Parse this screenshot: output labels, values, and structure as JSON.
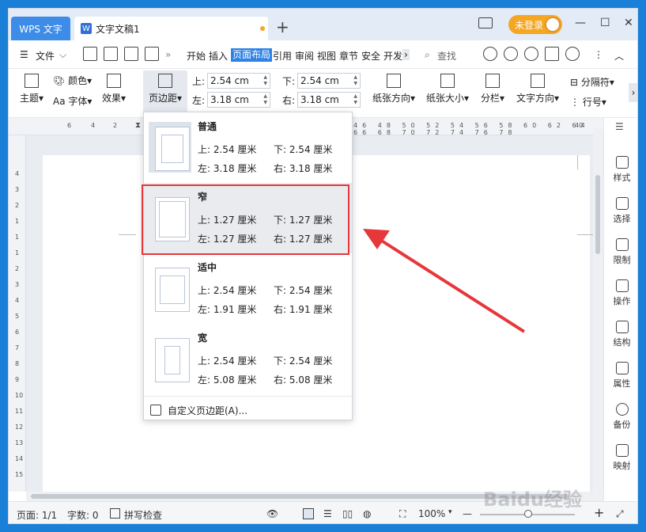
{
  "titlebar": {
    "app_tab": "WPS 文字",
    "doc_tab": "文字文稿1",
    "doc_icon": "W",
    "new_tab": "+",
    "login": "未登录",
    "window_controls": [
      "—",
      "☐",
      "✕"
    ]
  },
  "menubar": {
    "file_label": "文件",
    "tabs": [
      "开始",
      "插入",
      "页面布局",
      "引用",
      "审阅",
      "视图",
      "章节",
      "安全",
      "开发"
    ],
    "active_tab": "页面布局",
    "search_label": "查找"
  },
  "ribbon": {
    "theme": "主题",
    "color": "颜色",
    "font": "字体",
    "effect": "效果",
    "margins": "页边距",
    "top_label": "上:",
    "top_value": "2.54 cm",
    "bottom_label": "下:",
    "bottom_value": "2.54 cm",
    "left_label": "左:",
    "left_value": "3.18 cm",
    "right_label": "右:",
    "right_value": "3.18 cm",
    "orientation": "纸张方向",
    "size": "纸张大小",
    "columns": "分栏",
    "text_direction": "文字方向",
    "separator": "分隔符",
    "line_number": "行号"
  },
  "ruler": {
    "h_ticks": [
      "6",
      "4",
      "2",
      "40"
    ],
    "v_ticks": [
      "4",
      "3",
      "2",
      "1",
      "1",
      "1",
      "2",
      "3",
      "4",
      "5",
      "6",
      "7",
      "8",
      "9",
      "10",
      "11",
      "12",
      "13",
      "14",
      "15"
    ]
  },
  "margins_dropdown": {
    "options": [
      {
        "name": "普通",
        "top": "上: 2.54 厘米",
        "bottom": "下: 2.54 厘米",
        "left": "左: 3.18 厘米",
        "right": "右: 3.18 厘米"
      },
      {
        "name": "窄",
        "top": "上: 1.27 厘米",
        "bottom": "下: 1.27 厘米",
        "left": "左: 1.27 厘米",
        "right": "右: 1.27 厘米"
      },
      {
        "name": "适中",
        "top": "上: 2.54 厘米",
        "bottom": "下: 2.54 厘米",
        "left": "左: 1.91 厘米",
        "right": "右: 1.91 厘米"
      },
      {
        "name": "宽",
        "top": "上: 2.54 厘米",
        "bottom": "下: 2.54 厘米",
        "left": "左: 5.08 厘米",
        "right": "右: 5.08 厘米"
      }
    ],
    "custom": "自定义页边距(A)..."
  },
  "side_panel": [
    "样式",
    "选择",
    "限制",
    "操作",
    "结构",
    "属性",
    "备份",
    "映射"
  ],
  "statusbar": {
    "page": "页面: 1/1",
    "words": "字数: 0",
    "spell": "拼写检查",
    "zoom": "100%"
  },
  "watermark": "Baidu经验",
  "colors": {
    "accent": "#2f82e6",
    "highlight_box": "#e6373b",
    "login_bg": "#f5a623"
  }
}
